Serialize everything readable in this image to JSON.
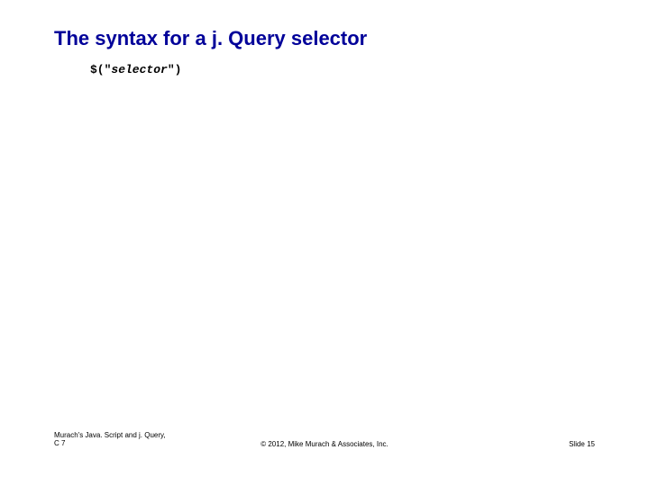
{
  "heading": "The syntax for a j. Query selector",
  "code": {
    "prefix": "$(\"",
    "selector": "selector",
    "suffix": "\")"
  },
  "footer": {
    "book_title": "Murach's Java. Script and j. Query,",
    "chapter": "C 7",
    "copyright": "© 2012, Mike Murach & Associates, Inc.",
    "slide": "Slide 15"
  }
}
